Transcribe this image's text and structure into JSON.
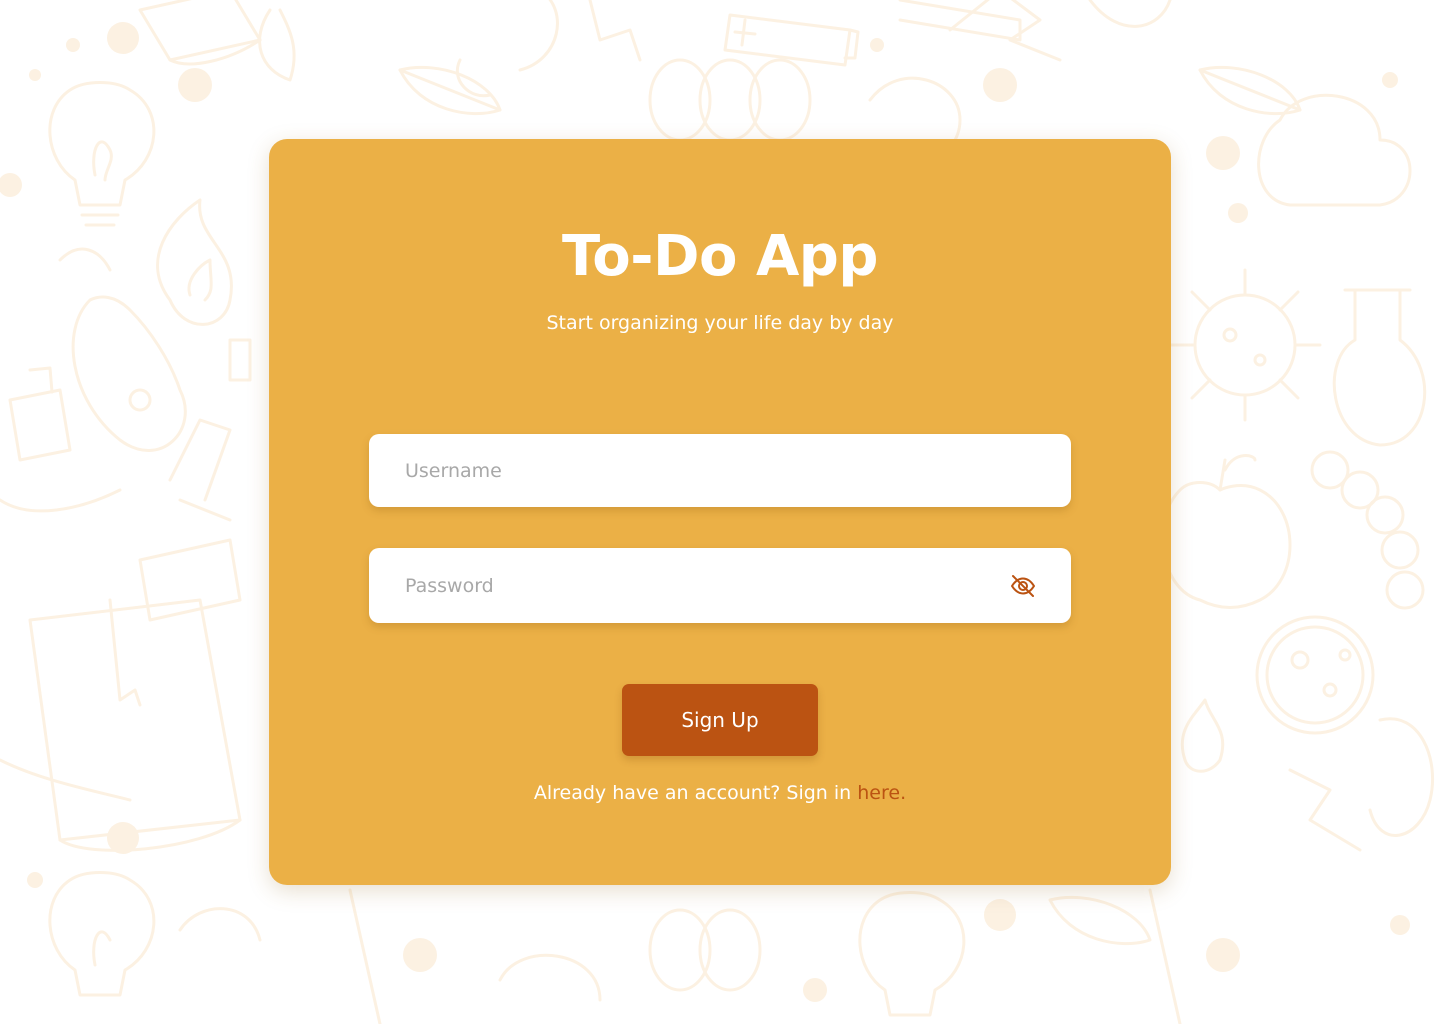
{
  "app": {
    "title": "To-Do App",
    "subtitle": "Start organizing your life day by day"
  },
  "form": {
    "username": {
      "placeholder": "Username",
      "value": ""
    },
    "password": {
      "placeholder": "Password",
      "value": "",
      "toggle_icon": "eye-off-icon"
    },
    "submit_label": "Sign Up"
  },
  "footer": {
    "prompt": "Already have an account? Sign in ",
    "link_text": "here",
    "suffix": "."
  },
  "colors": {
    "background": "#ffffff",
    "doodle": "#fcf1e2",
    "card": "#ebb046",
    "accent": "#bb5312",
    "input_bg": "#ffffff",
    "placeholder": "#a8a8a8",
    "text_light": "#ffffff"
  },
  "background": {
    "pattern": "doodle-illustrations",
    "icons": [
      "lightbulb-icon",
      "book-icon",
      "flame-icon",
      "leaf-icon",
      "battery-icon",
      "flask-icon",
      "virus-icon",
      "apple-icon",
      "microscope-icon",
      "lightning-icon",
      "petri-dish-icon"
    ]
  }
}
